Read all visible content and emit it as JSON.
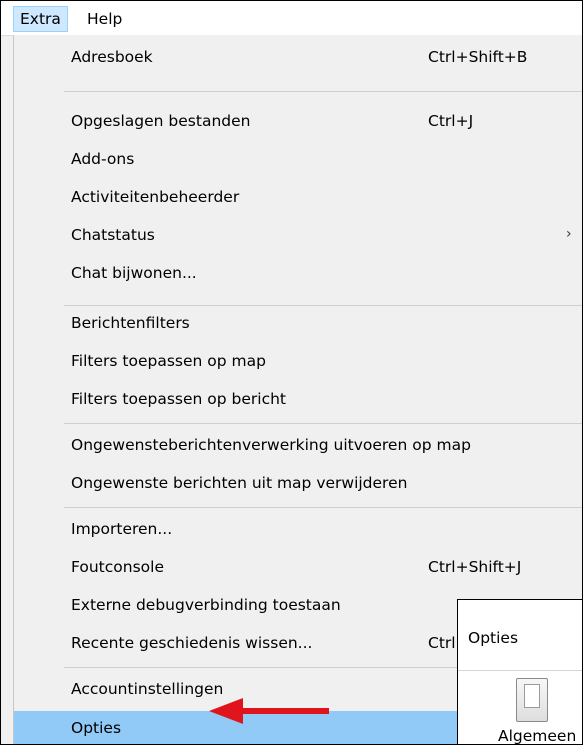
{
  "menubar": {
    "extra": "Extra",
    "help": "Help"
  },
  "menu": {
    "items": [
      {
        "label": "Adresboek",
        "shortcut": "Ctrl+Shift+B"
      },
      {
        "label": "Opgeslagen bestanden",
        "shortcut": "Ctrl+J"
      },
      {
        "label": "Add-ons",
        "shortcut": ""
      },
      {
        "label": "Activiteitenbeheerder",
        "shortcut": ""
      },
      {
        "label": "Chatstatus",
        "shortcut": "",
        "submenu_arrow": "›"
      },
      {
        "label": "Chat bijwonen...",
        "shortcut": ""
      },
      {
        "label": "Berichtenfilters",
        "shortcut": ""
      },
      {
        "label": "Filters toepassen op map",
        "shortcut": ""
      },
      {
        "label": "Filters toepassen op bericht",
        "shortcut": ""
      },
      {
        "label": "Ongewensteberichtenverwerking uitvoeren op map",
        "shortcut": ""
      },
      {
        "label": "Ongewenste berichten uit map verwijderen",
        "shortcut": ""
      },
      {
        "label": "Importeren...",
        "shortcut": ""
      },
      {
        "label": "Foutconsole",
        "shortcut": "Ctrl+Shift+J"
      },
      {
        "label": "Externe debugverbinding toestaan",
        "shortcut": ""
      },
      {
        "label": "Recente geschiedenis wissen...",
        "shortcut": "Ctrl"
      },
      {
        "label": "Accountinstellingen",
        "shortcut": ""
      },
      {
        "label": "Opties",
        "shortcut": ""
      }
    ],
    "selected_item": "Opties"
  },
  "dialog": {
    "title": "Opties",
    "tab_label": "Algemeen"
  },
  "colors": {
    "highlight": "#91c9f7",
    "arrow": "#e0141b"
  }
}
